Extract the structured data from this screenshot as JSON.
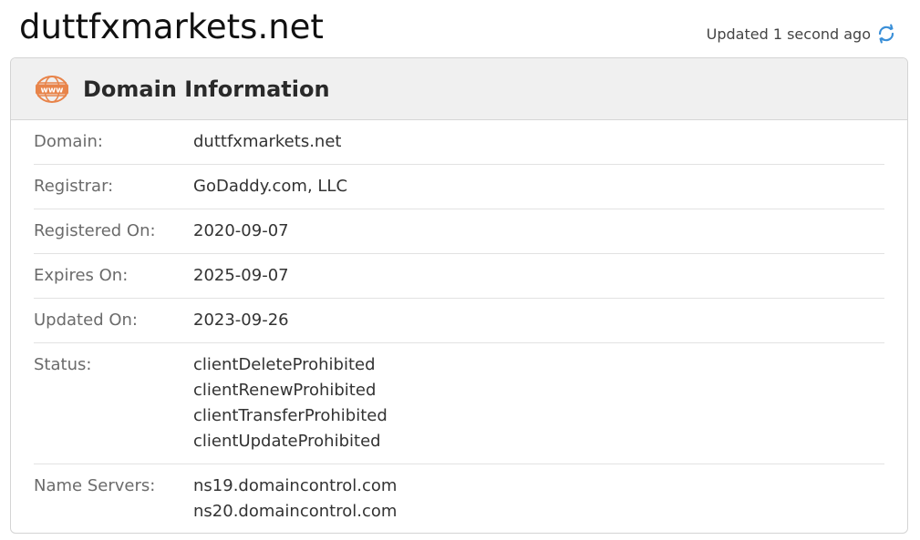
{
  "header": {
    "domain": "duttfxmarkets.net",
    "updated_text": "Updated 1 second ago",
    "refresh_icon": "refresh-icon"
  },
  "card": {
    "title": "Domain Information",
    "icon": "www-icon",
    "icon_text": "www",
    "accent_color": "#e8844a",
    "refresh_color": "#3a8fd8",
    "rows": {
      "domain": {
        "label": "Domain:",
        "value": "duttfxmarkets.net"
      },
      "registrar": {
        "label": "Registrar:",
        "value": "GoDaddy.com, LLC"
      },
      "registered_on": {
        "label": "Registered On:",
        "value": "2020-09-07"
      },
      "expires_on": {
        "label": "Expires On:",
        "value": "2025-09-07"
      },
      "updated_on": {
        "label": "Updated On:",
        "value": "2023-09-26"
      },
      "status": {
        "label": "Status:",
        "values": [
          "clientDeleteProhibited",
          "clientRenewProhibited",
          "clientTransferProhibited",
          "clientUpdateProhibited"
        ]
      },
      "name_servers": {
        "label": "Name Servers:",
        "values": [
          "ns19.domaincontrol.com",
          "ns20.domaincontrol.com"
        ]
      }
    }
  }
}
